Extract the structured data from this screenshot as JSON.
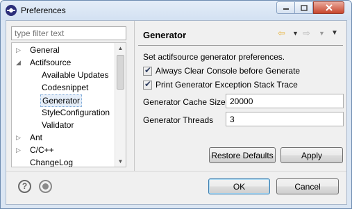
{
  "window": {
    "title": "Preferences",
    "controls": {
      "minimize_icon": "minimize-icon",
      "maximize_icon": "maximize-icon",
      "close_icon": "close-icon"
    }
  },
  "filter": {
    "placeholder": "type filter text"
  },
  "tree": {
    "items": [
      {
        "label": "General",
        "expander": "collapsed"
      },
      {
        "label": "Actifsource",
        "expander": "expanded"
      },
      {
        "label": "Available Updates"
      },
      {
        "label": "Codesnippet"
      },
      {
        "label": "Generator",
        "selected": true
      },
      {
        "label": "StyleConfiguration"
      },
      {
        "label": "Validator"
      },
      {
        "label": "Ant",
        "expander": "collapsed"
      },
      {
        "label": "C/C++",
        "expander": "collapsed"
      },
      {
        "label": "ChangeLog"
      }
    ]
  },
  "page": {
    "title": "Generator",
    "description": "Set actifsource generator preferences.",
    "options": [
      {
        "label": "Always Clear Console before Generate",
        "checked": true
      },
      {
        "label": "Print Generator Exception Stack Trace",
        "checked": true
      }
    ],
    "fields": [
      {
        "label": "Generator Cache Size",
        "value": "20000"
      },
      {
        "label": "Generator Threads",
        "value": "3"
      }
    ],
    "restore_defaults_label": "Restore Defaults",
    "apply_label": "Apply"
  },
  "footer": {
    "ok_label": "OK",
    "cancel_label": "Cancel"
  },
  "colors": {
    "accent": "#3c7fb1",
    "back_arrow": "#e8b84a"
  }
}
